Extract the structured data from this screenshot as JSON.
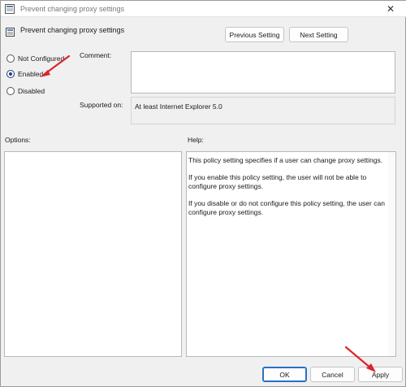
{
  "window": {
    "title": "Prevent changing proxy settings",
    "close_glyph": "✕"
  },
  "header": {
    "policy_name": "Prevent changing proxy settings",
    "previous_label": "Previous Setting",
    "next_label": "Next Setting"
  },
  "state": {
    "options": [
      {
        "label": "Not Configured",
        "selected": false
      },
      {
        "label": "Enabled",
        "selected": true
      },
      {
        "label": "Disabled",
        "selected": false
      }
    ]
  },
  "comment": {
    "label": "Comment:",
    "value": ""
  },
  "supported": {
    "label": "Supported on:",
    "value": "At least Internet Explorer 5.0"
  },
  "panels": {
    "options_label": "Options:",
    "help_label": "Help:",
    "help_paragraphs": [
      "This policy setting specifies if a user can change proxy settings.",
      "If you enable this policy setting, the user will not be able to configure proxy settings.",
      "If you disable or do not configure this policy setting, the user can configure proxy settings."
    ]
  },
  "footer": {
    "ok_label": "OK",
    "cancel_label": "Cancel",
    "apply_label": "Apply"
  },
  "colors": {
    "annotation_arrow": "#d9262b",
    "primary_border": "#2a6fc9"
  },
  "icons": {
    "window": "policy-window-icon",
    "policy": "policy-setting-icon",
    "close": "close-icon"
  }
}
